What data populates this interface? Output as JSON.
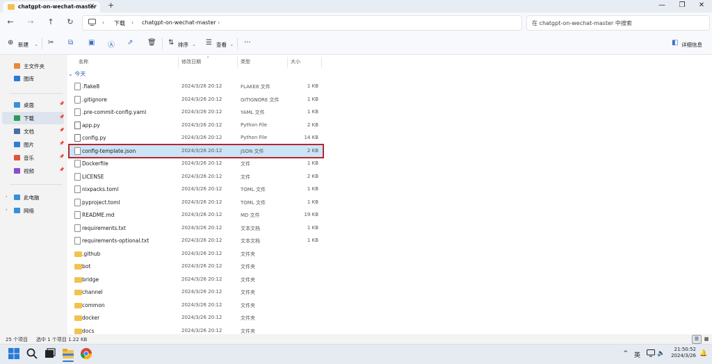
{
  "window": {
    "tab_title": "chatgpt-on-wechat-master",
    "tooltip": "chatgpt-on-wechat-master",
    "new_tab": "+",
    "close_tab": "×",
    "minimize": "—",
    "maximize": "❐",
    "close": "✕"
  },
  "nav": {
    "back": "←",
    "forward": "→",
    "up": "↑",
    "refresh": "↻",
    "breadcrumb": [
      "下载",
      "chatgpt-on-wechat-master"
    ],
    "search_placeholder": "在 chatgpt-on-wechat-master 中搜索"
  },
  "toolbar": {
    "new_label": "新建",
    "sort_label": "排序",
    "view_label": "查看",
    "more": "···",
    "details_label": "详细信息"
  },
  "sidebar": {
    "items": [
      {
        "label": "主文件夹",
        "icon": "home-icon",
        "color": "#e8893a"
      },
      {
        "label": "图库",
        "icon": "gallery-icon",
        "color": "#2a7bd4"
      },
      {
        "label": "桌面",
        "icon": "desktop-icon",
        "color": "#3a8fd8"
      },
      {
        "label": "下载",
        "icon": "download-icon",
        "color": "#2a9d52"
      },
      {
        "label": "文档",
        "icon": "document-icon",
        "color": "#4a6fa8"
      },
      {
        "label": "图片",
        "icon": "pictures-icon",
        "color": "#2f7fd6"
      },
      {
        "label": "音乐",
        "icon": "music-icon",
        "color": "#e0533d"
      },
      {
        "label": "视频",
        "icon": "video-icon",
        "color": "#8a4bd1"
      },
      {
        "label": "此电脑",
        "icon": "pc-icon",
        "color": "#3a8fd8"
      },
      {
        "label": "网络",
        "icon": "network-icon",
        "color": "#3a8fd8"
      }
    ]
  },
  "columns": {
    "name": "名称",
    "date": "修改日期",
    "type": "类型",
    "size": "大小"
  },
  "group_label": "今天",
  "files": [
    {
      "name": ".flake8",
      "date": "2024/3/26 20:12",
      "type": "FLAKE8 文件",
      "size": "1 KB",
      "kind": "file"
    },
    {
      "name": ".gitignore",
      "date": "2024/3/26 20:12",
      "type": "GITIGNORE 文件",
      "size": "1 KB",
      "kind": "file"
    },
    {
      "name": ".pre-commit-config.yaml",
      "date": "2024/3/26 20:12",
      "type": "YAML 文件",
      "size": "1 KB",
      "kind": "file"
    },
    {
      "name": "app.py",
      "date": "2024/3/26 20:12",
      "type": "Python File",
      "size": "2 KB",
      "kind": "code"
    },
    {
      "name": "config.py",
      "date": "2024/3/26 20:12",
      "type": "Python File",
      "size": "14 KB",
      "kind": "code"
    },
    {
      "name": "config-template.json",
      "date": "2024/3/26 20:12",
      "type": "JSON 文件",
      "size": "2 KB",
      "kind": "file",
      "selected": true
    },
    {
      "name": "Dockerfile",
      "date": "2024/3/26 20:12",
      "type": "文件",
      "size": "1 KB",
      "kind": "file"
    },
    {
      "name": "LICENSE",
      "date": "2024/3/26 20:12",
      "type": "文件",
      "size": "2 KB",
      "kind": "file"
    },
    {
      "name": "nixpacks.toml",
      "date": "2024/3/26 20:12",
      "type": "TOML 文件",
      "size": "1 KB",
      "kind": "file"
    },
    {
      "name": "pyproject.toml",
      "date": "2024/3/26 20:12",
      "type": "TOML 文件",
      "size": "1 KB",
      "kind": "file"
    },
    {
      "name": "README.md",
      "date": "2024/3/26 20:12",
      "type": "MD 文件",
      "size": "19 KB",
      "kind": "file"
    },
    {
      "name": "requirements.txt",
      "date": "2024/3/26 20:12",
      "type": "文本文档",
      "size": "1 KB",
      "kind": "file"
    },
    {
      "name": "requirements-optional.txt",
      "date": "2024/3/26 20:12",
      "type": "文本文档",
      "size": "1 KB",
      "kind": "file"
    },
    {
      "name": ".github",
      "date": "2024/3/26 20:12",
      "type": "文件夹",
      "size": "",
      "kind": "folder"
    },
    {
      "name": "bot",
      "date": "2024/3/26 20:12",
      "type": "文件夹",
      "size": "",
      "kind": "folder"
    },
    {
      "name": "bridge",
      "date": "2024/3/26 20:12",
      "type": "文件夹",
      "size": "",
      "kind": "folder"
    },
    {
      "name": "channel",
      "date": "2024/3/26 20:12",
      "type": "文件夹",
      "size": "",
      "kind": "folder"
    },
    {
      "name": "common",
      "date": "2024/3/26 20:12",
      "type": "文件夹",
      "size": "",
      "kind": "folder"
    },
    {
      "name": "docker",
      "date": "2024/3/26 20:12",
      "type": "文件夹",
      "size": "",
      "kind": "folder"
    },
    {
      "name": "docs",
      "date": "2024/3/26 20:12",
      "type": "文件夹",
      "size": "",
      "kind": "folder"
    }
  ],
  "status": {
    "item_count": "25 个项目",
    "selection": "选中 1 个项目  1.22 KB"
  },
  "taskbar": {
    "tray_chevron": "^",
    "ime": "英",
    "clock_time": "21:50:52",
    "clock_date": "2024/3/26"
  }
}
